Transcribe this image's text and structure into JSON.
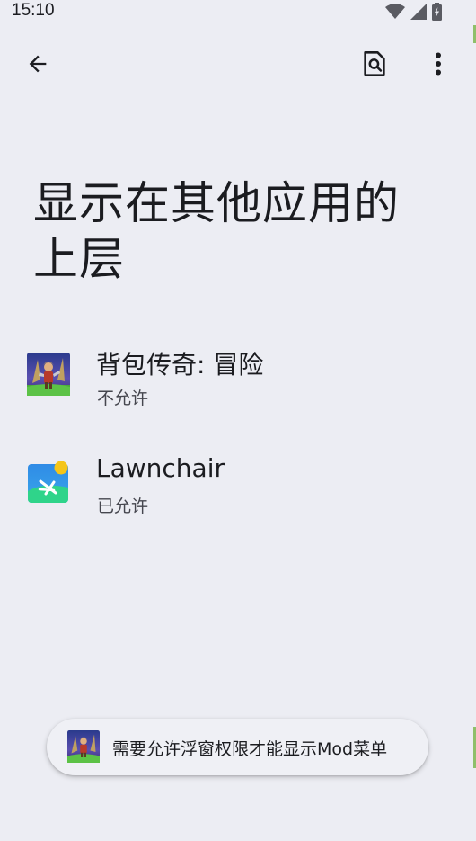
{
  "status_bar": {
    "time": "15:10",
    "icons": [
      "wifi-icon",
      "signal-icon",
      "battery-icon"
    ]
  },
  "app_bar": {
    "back_icon": "arrow-back-icon",
    "search_icon": "search-in-page-icon",
    "more_icon": "more-vert-icon"
  },
  "page": {
    "title_line1": "显示在其他应用的",
    "title_line2": "上层"
  },
  "apps": [
    {
      "name": "背包传奇: 冒险",
      "status": "不允许",
      "icon": "game-hero-icon"
    },
    {
      "name": "Lawnchair",
      "status": "已允许",
      "icon": "lawnchair-icon"
    }
  ],
  "toast": {
    "message": "需要允许浮窗权限才能显示Mod菜单",
    "icon": "game-hero-icon"
  },
  "colors": {
    "background": "#ecedf3",
    "text_primary": "#1b1c20",
    "text_secondary": "#45464e",
    "lawnchair_blue": "#2f8be6",
    "lawnchair_green": "#2fd48a",
    "lawnchair_sun": "#f5c518"
  }
}
